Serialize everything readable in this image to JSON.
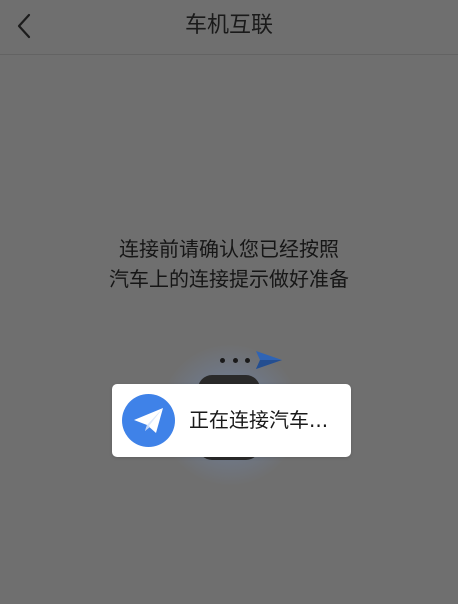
{
  "header": {
    "back_icon": "chevron-left-icon",
    "title": "车机互联"
  },
  "instructions": {
    "line1": "连接前请确认您已经按照",
    "line2": "汽车上的连接提示做好准备"
  },
  "illustration": {
    "send_icon": "paper-plane-icon",
    "dots_icon": "ellipsis-icon",
    "accent_color": "#3f82e8"
  },
  "toast": {
    "icon": "paper-plane-icon",
    "message": "正在连接汽车..."
  }
}
